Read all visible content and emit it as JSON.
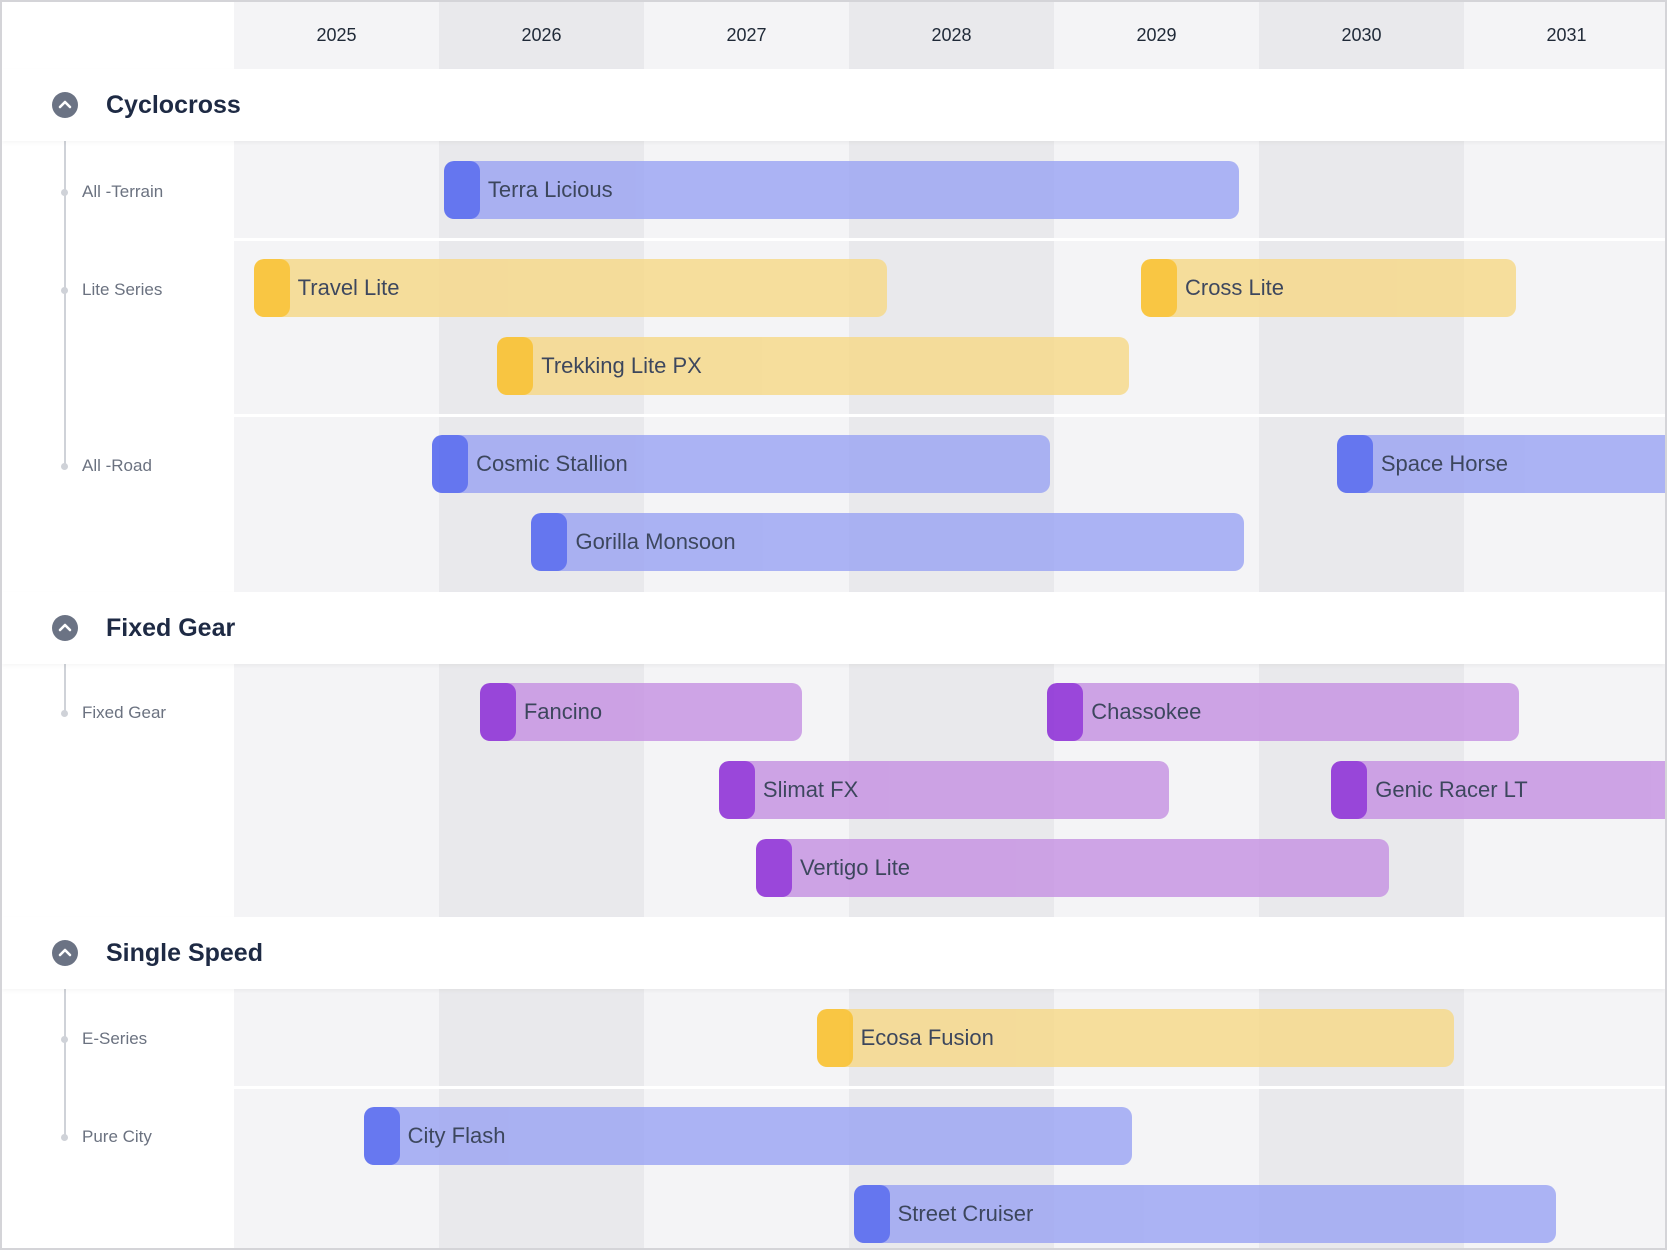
{
  "years": [
    "2025",
    "2026",
    "2027",
    "2028",
    "2029",
    "2030",
    "2031"
  ],
  "colors": {
    "blue_fill": "#9ea7f3",
    "blue_cap": "#4f63f0",
    "yellow_fill": "#f6d98c",
    "yellow_cap": "#fbbf24",
    "purple_fill": "#c795e3",
    "purple_cap": "#8b2ad6",
    "band_light": "#f4f4f6",
    "band_dark": "#e9e9ec"
  },
  "groups": [
    {
      "title": "Cyclocross",
      "rows": [
        {
          "label": "All -Terrain"
        },
        {
          "label": "Lite Series"
        },
        {
          "label": "All -Road"
        }
      ]
    },
    {
      "title": "Fixed Gear",
      "rows": [
        {
          "label": "Fixed Gear"
        }
      ]
    },
    {
      "title": "Single Speed",
      "rows": [
        {
          "label": "E-Series"
        },
        {
          "label": "Pure City"
        }
      ]
    }
  ],
  "bars": [
    {
      "name": "Terra Licious",
      "color": "blue",
      "start": "2026-01-10",
      "end": "2029-11-27"
    },
    {
      "name": "Travel Lite",
      "color": "yellow",
      "start": "2025-02-05",
      "end": "2028-03-10"
    },
    {
      "name": "Cross Lite",
      "color": "yellow",
      "start": "2029-06-05",
      "end": "2031-04-05"
    },
    {
      "name": "Trekking Lite PX",
      "color": "yellow",
      "start": "2026-04-15",
      "end": "2029-05-15"
    },
    {
      "name": "Cosmic Stallion",
      "color": "blue",
      "start": "2025-12-20",
      "end": "2028-12-25"
    },
    {
      "name": "Space Horse",
      "color": "blue",
      "start": "2030-05-20",
      "end": "2031-12-31"
    },
    {
      "name": "Gorilla Monsoon",
      "color": "blue",
      "start": "2026-06-15",
      "end": "2029-12-05"
    },
    {
      "name": "Fancino",
      "color": "purple",
      "start": "2026-03-15",
      "end": "2027-10-10"
    },
    {
      "name": "Chassokee",
      "color": "purple",
      "start": "2028-12-20",
      "end": "2031-04-10"
    },
    {
      "name": "Slimat FX",
      "color": "purple",
      "start": "2027-05-15",
      "end": "2029-07-25"
    },
    {
      "name": "Genic Racer LT",
      "color": "purple",
      "start": "2030-05-10",
      "end": "2031-12-31"
    },
    {
      "name": "Vertigo Lite",
      "color": "purple",
      "start": "2027-07-20",
      "end": "2030-08-20"
    },
    {
      "name": "Ecosa Fusion",
      "color": "yellow",
      "start": "2027-11-05",
      "end": "2030-12-15"
    },
    {
      "name": "City Flash",
      "color": "blue",
      "start": "2025-08-20",
      "end": "2029-05-20"
    },
    {
      "name": "Street Cruiser",
      "color": "blue",
      "start": "2028-01-10",
      "end": "2031-06-15"
    }
  ]
}
